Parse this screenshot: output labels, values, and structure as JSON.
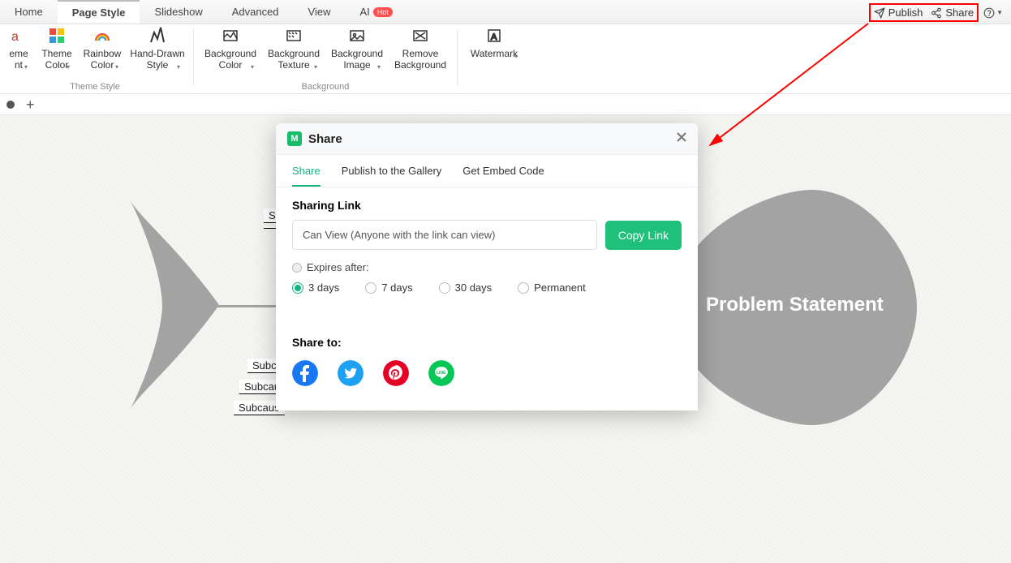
{
  "tabs": {
    "home": "Home",
    "page_style": "Page Style",
    "slideshow": "Slideshow",
    "advanced": "Advanced",
    "view": "View",
    "ai": "AI",
    "hot_badge": "Hot"
  },
  "top_right": {
    "publish": "Publish",
    "share": "Share"
  },
  "ribbon": {
    "theme_font": "eme nt",
    "theme_color": "Theme Color",
    "rainbow_color": "Rainbow Color",
    "hand_drawn": "Hand-Drawn Style",
    "group_theme": "Theme Style",
    "bg_color": "Background Color",
    "bg_texture": "Background Texture",
    "bg_image": "Background Image",
    "remove_bg": "Remove Background",
    "watermark": "Watermark",
    "group_bg": "Background"
  },
  "canvas": {
    "problem": "Problem Statement",
    "sub1_top": "S",
    "sub1": "Subc",
    "sub2": "Subcau",
    "sub3": "Subcaus"
  },
  "dialog": {
    "title": "Share",
    "tabs": {
      "share": "Share",
      "publish": "Publish to the Gallery",
      "embed": "Get Embed Code"
    },
    "sharing_link": "Sharing Link",
    "link_value": "Can View (Anyone with the link can view)",
    "copy": "Copy Link",
    "expires_after": "Expires after:",
    "opt_3d": "3 days",
    "opt_7d": "7 days",
    "opt_30d": "30 days",
    "opt_perm": "Permanent",
    "share_to": "Share to:"
  },
  "colors": {
    "accent": "#17b57a",
    "annotation": "#ff0000"
  }
}
